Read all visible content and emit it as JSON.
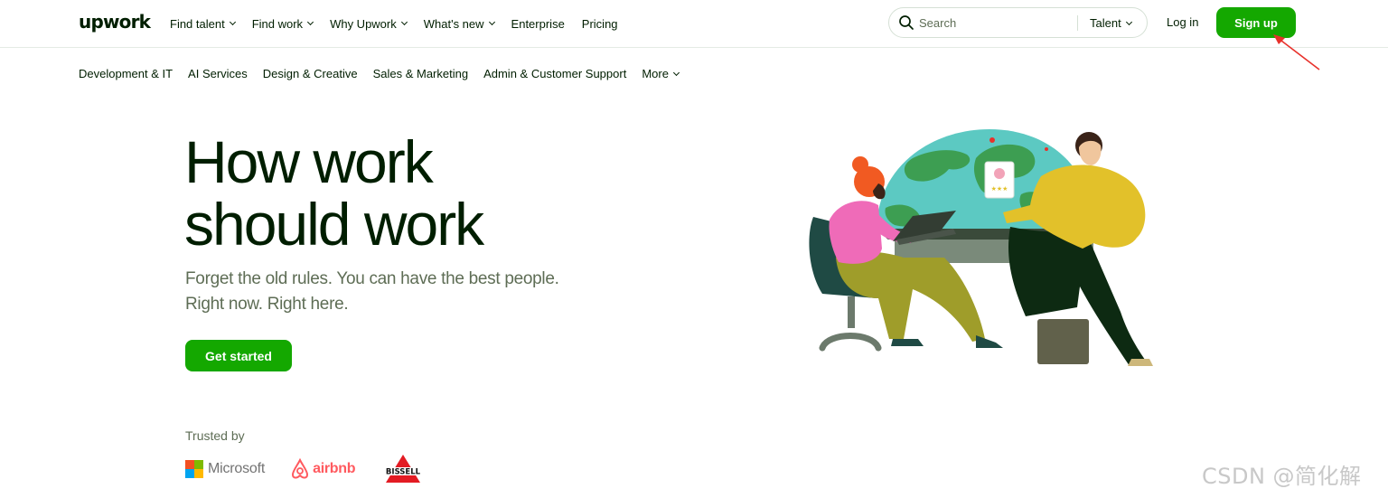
{
  "header": {
    "logo_text": "upwork",
    "nav": [
      {
        "label": "Find talent",
        "has_dropdown": true
      },
      {
        "label": "Find work",
        "has_dropdown": true
      },
      {
        "label": "Why Upwork",
        "has_dropdown": true
      },
      {
        "label": "What's new",
        "has_dropdown": true
      },
      {
        "label": "Enterprise",
        "has_dropdown": false
      },
      {
        "label": "Pricing",
        "has_dropdown": false
      }
    ],
    "search": {
      "placeholder": "Search",
      "scope": "Talent"
    },
    "login_label": "Log in",
    "signup_label": "Sign up"
  },
  "categories": {
    "items": [
      {
        "label": "Development & IT"
      },
      {
        "label": "AI Services"
      },
      {
        "label": "Design & Creative"
      },
      {
        "label": "Sales & Marketing"
      },
      {
        "label": "Admin & Customer Support"
      },
      {
        "label": "More"
      }
    ]
  },
  "hero": {
    "headline_line1": "How work",
    "headline_line2": "should work",
    "subtext_line1": "Forget the old rules. You can have the best people.",
    "subtext_line2": "Right now. Right here.",
    "cta_label": "Get started"
  },
  "trusted": {
    "label": "Trusted by",
    "brands": [
      "Microsoft",
      "airbnb",
      "BISSELL"
    ]
  },
  "watermark": "CSDN @简化解",
  "colors": {
    "brand_green": "#14a800",
    "text_dark": "#001e00",
    "text_muted": "#5e6d55",
    "annotation_red": "#e8312b"
  }
}
